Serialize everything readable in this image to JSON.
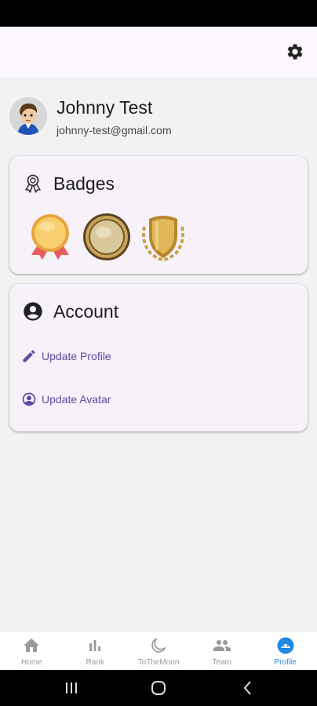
{
  "profile": {
    "name": "Johnny Test",
    "email": "johnny-test@gmail.com"
  },
  "badges_card": {
    "title": "Badges",
    "badges": [
      {
        "icon": "gold-medal-ribbon-icon"
      },
      {
        "icon": "gold-coin-medal-icon"
      },
      {
        "icon": "gold-shield-laurel-icon"
      }
    ]
  },
  "account_card": {
    "title": "Account",
    "actions": [
      {
        "label": "Update Profile",
        "icon": "pencil-icon"
      },
      {
        "label": "Update Avatar",
        "icon": "account-circle-icon"
      }
    ]
  },
  "bottom_nav": {
    "items": [
      {
        "label": "Home",
        "icon": "home-icon"
      },
      {
        "label": "Rank",
        "icon": "bar-chart-icon"
      },
      {
        "label": "ToTheMoon",
        "icon": "moon-icon"
      },
      {
        "label": "Team",
        "icon": "people-icon"
      },
      {
        "label": "Profile",
        "icon": "profile-face-icon",
        "active": true
      }
    ]
  },
  "colors": {
    "accent": "#5a4a9e",
    "active_nav": "#1e88e5",
    "card_bg": "#f7f2fa",
    "page_bg": "#f2f2f2"
  }
}
